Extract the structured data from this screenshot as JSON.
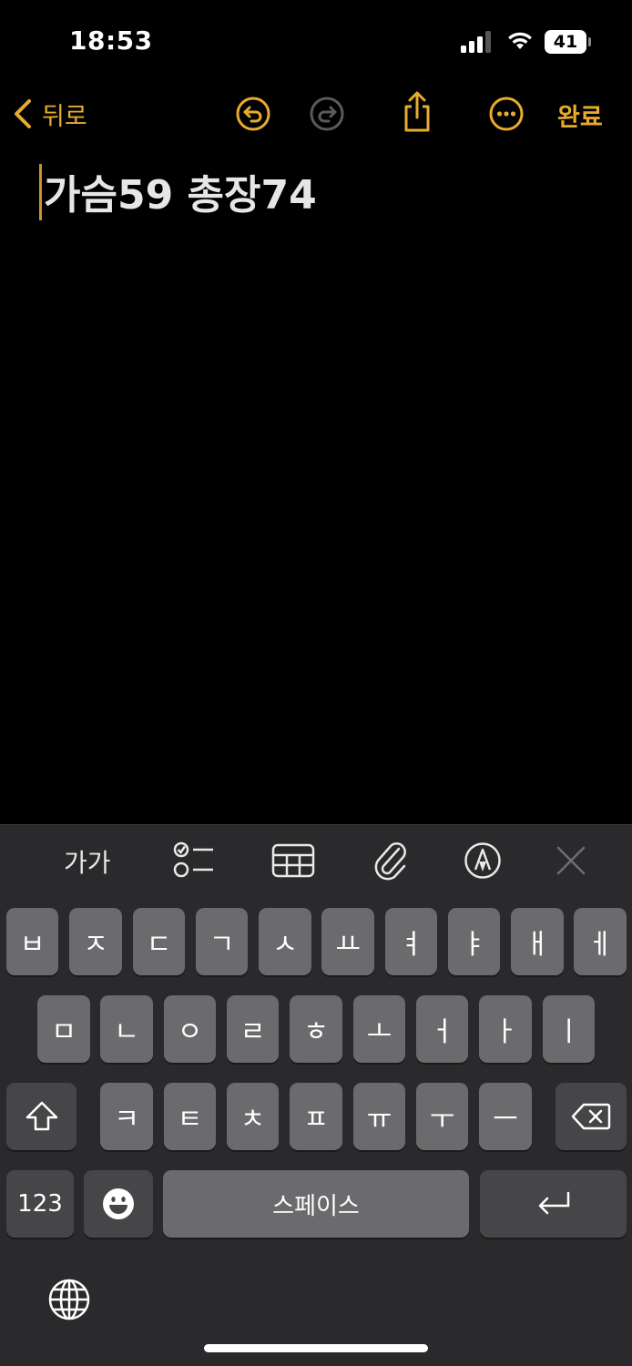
{
  "status_bar": {
    "time": "18:53",
    "battery": "41",
    "icons": [
      "cellular-signal-icon",
      "wifi-icon",
      "battery-icon"
    ]
  },
  "nav": {
    "back_label": "뒤로",
    "done_label": "완료",
    "icons": [
      "chevron-left-icon",
      "undo-icon",
      "redo-icon",
      "share-icon",
      "more-icon"
    ]
  },
  "note": {
    "text": "가슴59 총장74"
  },
  "toolbar": {
    "format_label": "가가",
    "icons": [
      "checklist-icon",
      "table-icon",
      "attachment-icon",
      "markup-icon",
      "close-icon"
    ]
  },
  "keyboard": {
    "row1": [
      "ㅂ",
      "ㅈ",
      "ㄷ",
      "ㄱ",
      "ㅅ",
      "ㅛ",
      "ㅕ",
      "ㅑ",
      "ㅐ",
      "ㅔ"
    ],
    "row2": [
      "ㅁ",
      "ㄴ",
      "ㅇ",
      "ㄹ",
      "ㅎ",
      "ㅗ",
      "ㅓ",
      "ㅏ",
      "ㅣ"
    ],
    "row3": [
      "ㅋ",
      "ㅌ",
      "ㅊ",
      "ㅍ",
      "ㅠ",
      "ㅜ",
      "ㅡ"
    ],
    "numbers_label": "123",
    "space_label": "스페이스",
    "icons": [
      "shift-icon",
      "backspace-icon",
      "emoji-icon",
      "return-icon",
      "globe-icon"
    ]
  },
  "colors": {
    "accent": "#E8AB2E",
    "background": "#000000",
    "keyboard_bg": "#2a2a2c",
    "key": "#6b6b6e",
    "key_dark": "#464648"
  }
}
